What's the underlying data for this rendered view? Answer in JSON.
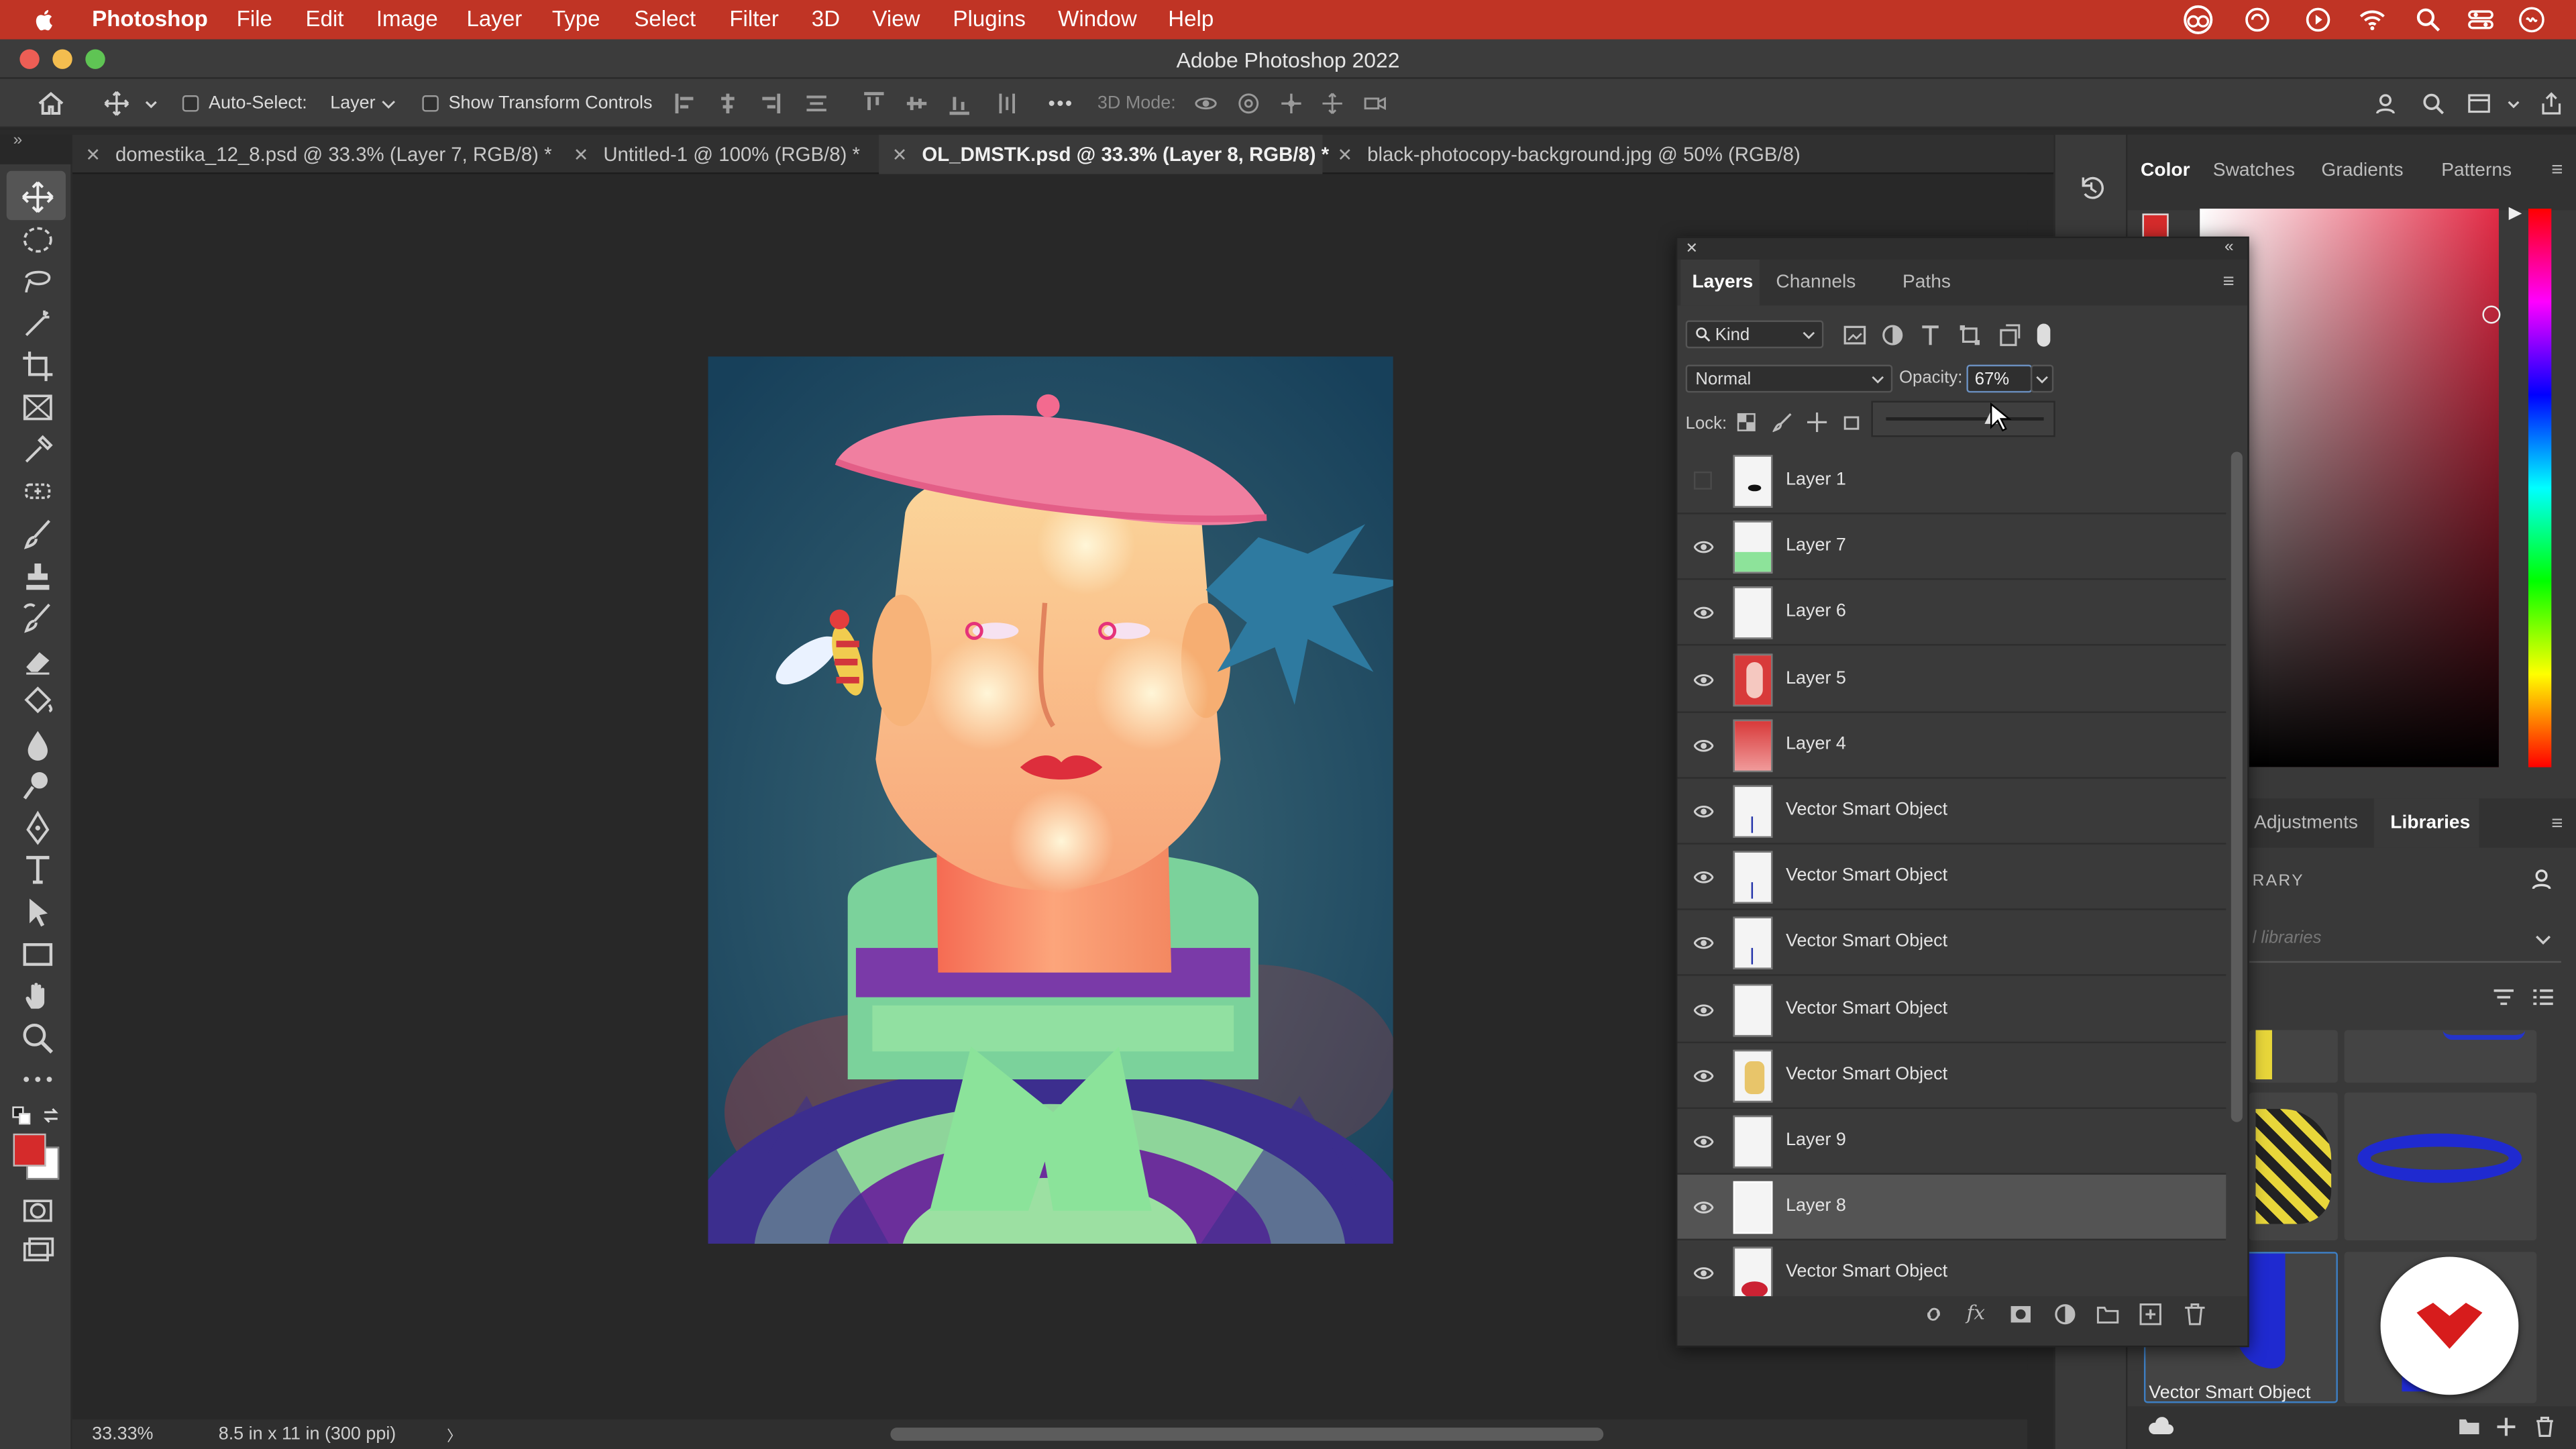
{
  "menubar": {
    "app_name": "Photoshop",
    "items": [
      "File",
      "Edit",
      "Image",
      "Layer",
      "Type",
      "Select",
      "Filter",
      "3D",
      "View",
      "Plugins",
      "Window",
      "Help"
    ]
  },
  "window": {
    "title": "Adobe Photoshop 2022"
  },
  "options_bar": {
    "auto_select_label": "Auto-Select:",
    "auto_select_value": "Layer",
    "show_transform_label": "Show Transform Controls",
    "three_d_mode_label": "3D Mode:",
    "more_glyph": "•••"
  },
  "tabs": [
    {
      "label": "domestika_12_8.psd @ 33.3% (Layer 7, RGB/8) *"
    },
    {
      "label": "Untitled-1 @ 100% (RGB/8) *"
    },
    {
      "label": "OL_DMSTK.psd @ 33.3% (Layer 8, RGB/8) *"
    },
    {
      "label": "black-photocopy-background.jpg @ 50% (RGB/8)"
    }
  ],
  "tab_close_glyph": "✕",
  "status": {
    "zoom": "33.33%",
    "doc_size": "8.5 in x 11 in (300 ppi)",
    "arrow": "〉"
  },
  "colors": {
    "menubar": "#c03425",
    "foreground_swatch": "#d52b2b",
    "background_swatch": "#ffffff",
    "canvas_bg": "#1f4960",
    "accent_badge": "#d71c1c"
  },
  "color_panel": {
    "tabs": [
      "Color",
      "Swatches",
      "Gradients",
      "Patterns"
    ],
    "active": "Color"
  },
  "libraries_panel": {
    "tabs": [
      "Adjustments",
      "Libraries"
    ],
    "active": "Libraries",
    "library_label": "RARY",
    "search_placeholder": "l libraries",
    "selected_item_label": "Vector Smart Object"
  },
  "layers_panel": {
    "tabs": [
      "Layers",
      "Channels",
      "Paths"
    ],
    "active": "Layers",
    "filter_label": "Kind",
    "blend_mode": "Normal",
    "opacity_label": "Opacity:",
    "opacity_value": "67%",
    "opacity_fraction": 0.67,
    "lock_label": "Lock:",
    "layers": [
      {
        "name": "Layer 1",
        "visible": false,
        "selected": false,
        "thumb": "dot"
      },
      {
        "name": "Layer 7",
        "visible": true,
        "selected": false,
        "thumb": "green"
      },
      {
        "name": "Layer 6",
        "visible": true,
        "selected": false,
        "thumb": "blank"
      },
      {
        "name": "Layer 5",
        "visible": true,
        "selected": false,
        "thumb": "red-figure"
      },
      {
        "name": "Layer 4",
        "visible": true,
        "selected": false,
        "thumb": "red"
      },
      {
        "name": "Vector Smart Object",
        "visible": true,
        "selected": false,
        "thumb": "line"
      },
      {
        "name": "Vector Smart Object",
        "visible": true,
        "selected": false,
        "thumb": "line"
      },
      {
        "name": "Vector Smart Object",
        "visible": true,
        "selected": false,
        "thumb": "line"
      },
      {
        "name": "Vector Smart Object",
        "visible": true,
        "selected": false,
        "thumb": "blank"
      },
      {
        "name": "Vector Smart Object",
        "visible": true,
        "selected": false,
        "thumb": "figure"
      },
      {
        "name": "Layer 9",
        "visible": true,
        "selected": false,
        "thumb": "blank"
      },
      {
        "name": "Layer 8",
        "visible": true,
        "selected": true,
        "thumb": "blank"
      },
      {
        "name": "Vector Smart Object",
        "visible": true,
        "selected": false,
        "thumb": "bee"
      }
    ]
  }
}
